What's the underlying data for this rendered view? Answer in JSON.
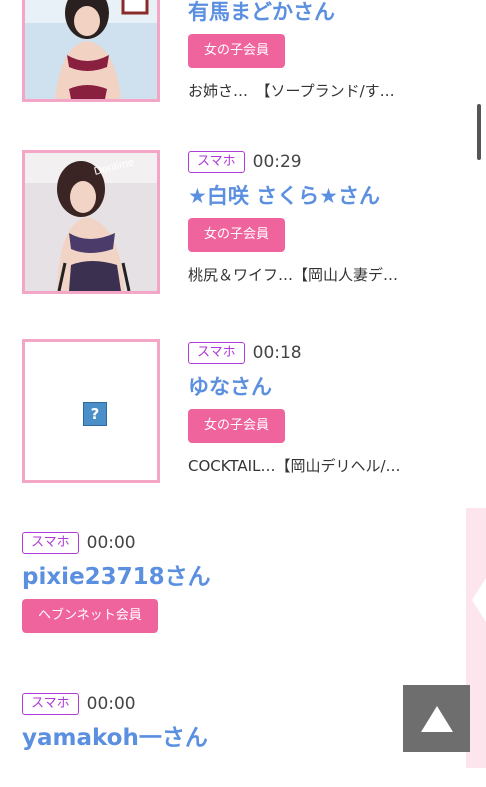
{
  "posts": [
    {
      "name": "有馬まどかさん",
      "member_label": "女の子会員",
      "desc": "お姉さ…　【ソープランド/す…",
      "thumb": "photo"
    },
    {
      "badge": "スマホ",
      "time": "00:29",
      "name": "★白咲 さくら★さん",
      "member_label": "女の子会員",
      "desc": "桃尻＆ワイフ…【岡山人妻デ…",
      "thumb": "photo"
    },
    {
      "badge": "スマホ",
      "time": "00:18",
      "name": "ゆなさん",
      "member_label": "女の子会員",
      "desc": "COCKTAIL…【岡山デリヘル/…",
      "thumb": "missing"
    },
    {
      "badge": "スマホ",
      "time": "00:00",
      "name": "pixie23718さん",
      "member_label": "ヘブンネット会員"
    },
    {
      "badge": "スマホ",
      "time": "00:00",
      "name": "yamakoh一さん"
    }
  ],
  "icons": {
    "missing_image": "question-mark-icon",
    "back_to_top": "triangle-up-icon"
  },
  "colors": {
    "accent_pink": "#f0649e",
    "thumb_border": "#f4a6c6",
    "badge_purple": "#b03ad8",
    "name_blue": "#5b8fe0"
  }
}
